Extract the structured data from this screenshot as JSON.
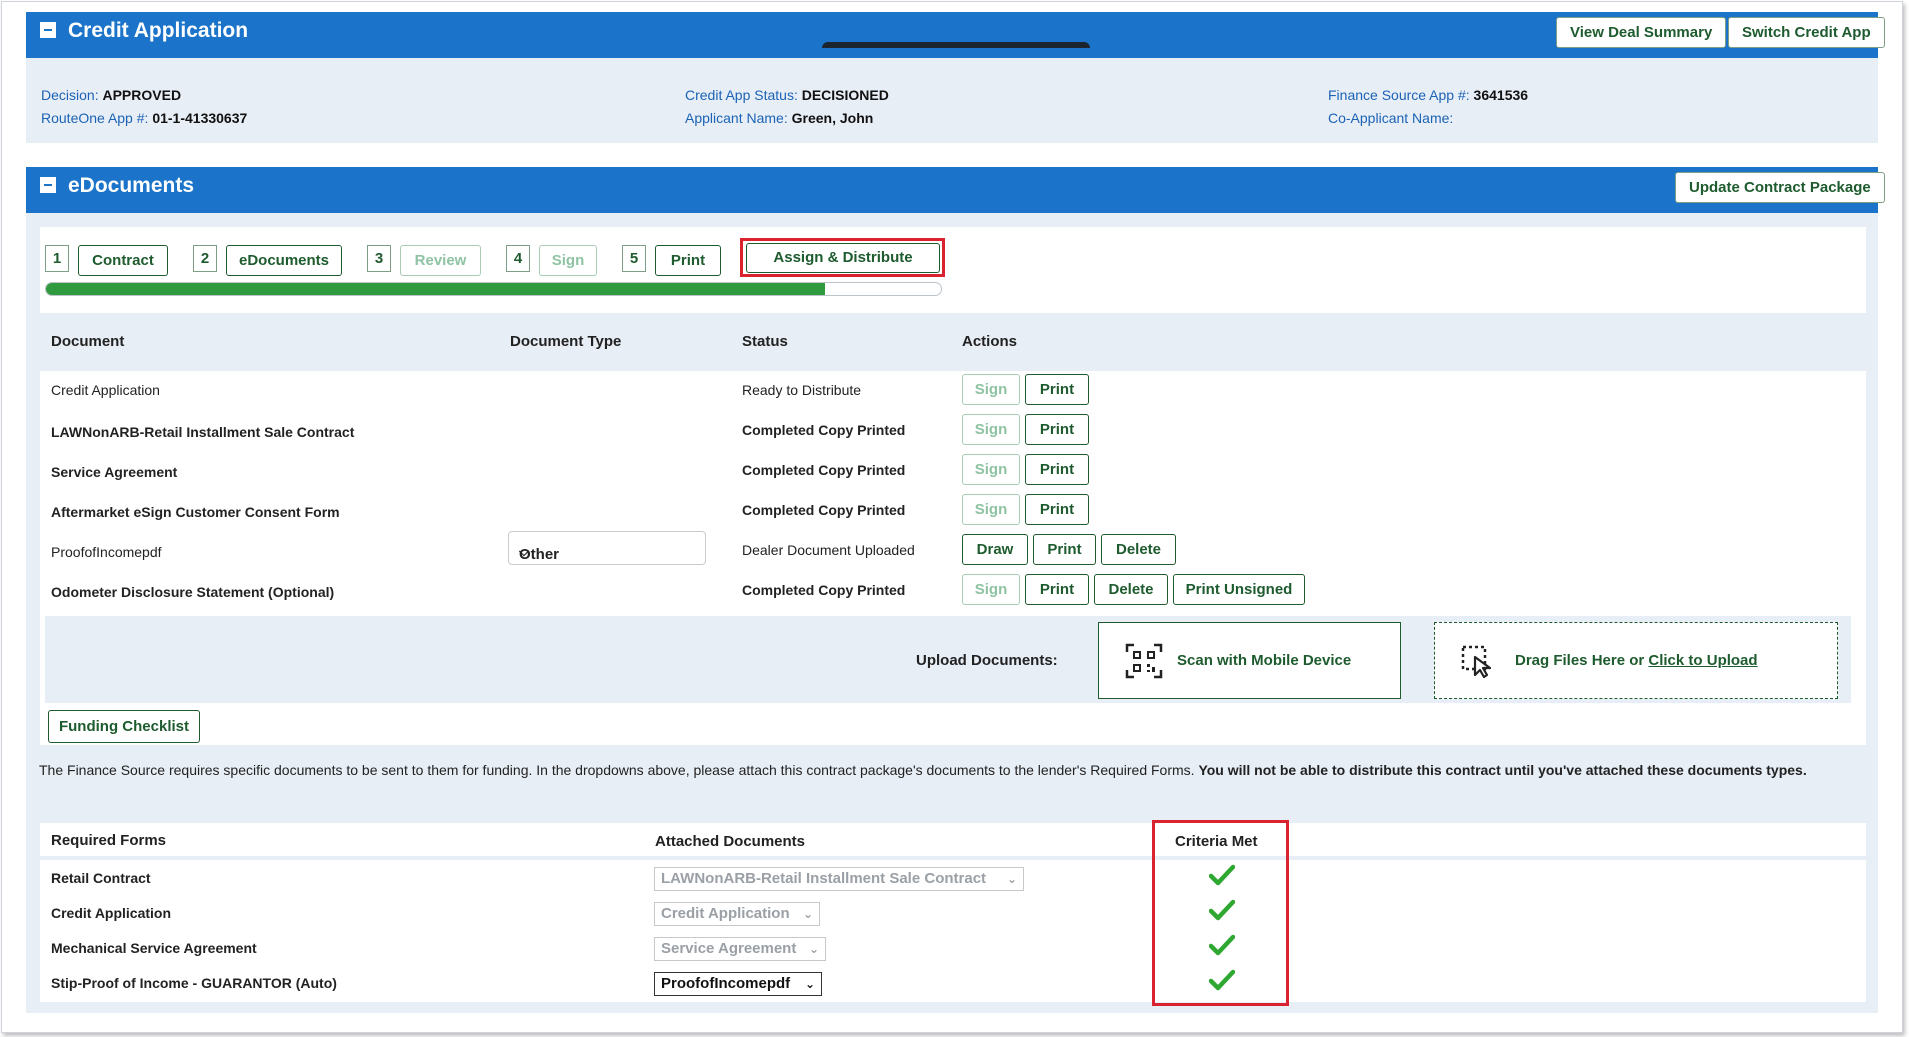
{
  "credit_app": {
    "title": "Credit Application",
    "buttons": [
      "View Deal Summary",
      "Switch Credit App"
    ],
    "decision_label": "Decision:",
    "decision_value": "APPROVED",
    "routeone_label": "RouteOne App #:",
    "routeone_value": "01-1-41330637",
    "status_label": "Credit App Status:",
    "status_value": "DECISIONED",
    "applicant_label": "Applicant Name:",
    "applicant_value": "Green, John",
    "finance_label": "Finance Source App #:",
    "finance_value": "3641536",
    "coapplicant_label": "Co-Applicant Name:",
    "coapplicant_value": ""
  },
  "edocs": {
    "title": "eDocuments",
    "update_button": "Update Contract Package",
    "steps": [
      {
        "num": "1",
        "label": "Contract",
        "enabled": true
      },
      {
        "num": "2",
        "label": "eDocuments",
        "enabled": true
      },
      {
        "num": "3",
        "label": "Review",
        "enabled": false
      },
      {
        "num": "4",
        "label": "Sign",
        "enabled": false
      },
      {
        "num": "5",
        "label": "Print",
        "enabled": true
      }
    ],
    "assign_button": "Assign & Distribute",
    "progress_fraction": 0.87,
    "columns": [
      "Document",
      "Document Type",
      "Status",
      "Actions"
    ],
    "rows": [
      {
        "document": "Credit Application",
        "status": "Ready to Distribute"
      },
      {
        "document": "LAWNonARB-Retail Installment Sale Contract",
        "status": "Completed Copy Printed"
      },
      {
        "document": "Service Agreement",
        "status": "Completed Copy Printed"
      },
      {
        "document": "Aftermarket eSign Customer Consent Form",
        "status": "Completed Copy Printed"
      },
      {
        "document": "ProofofIncomepdf",
        "doc_type": "Other",
        "status": "Dealer Document Uploaded"
      },
      {
        "document": "Odometer Disclosure Statement (Optional)",
        "status": "Completed Copy Printed"
      }
    ],
    "actions": {
      "sign": "Sign",
      "print": "Print",
      "draw": "Draw",
      "delete": "Delete",
      "print_unsigned": "Print Unsigned"
    },
    "upload_label": "Upload Documents:",
    "scan_label": "Scan with Mobile Device",
    "drag_prefix": "Drag Files Here or ",
    "drag_link": "Click to Upload",
    "funding_button": "Funding Checklist",
    "note_text": "The Finance Source requires specific documents to be sent to them for funding. In the dropdowns above, please attach this contract package's documents to the lender's Required Forms. ",
    "note_bold": "You will not be able to distribute this contract until you've attached these documents types.",
    "req_columns": [
      "Required Forms",
      "Attached Documents",
      "Criteria Met"
    ],
    "req_rows": [
      {
        "form": "Retail Contract",
        "attached": "LAWNonARB-Retail Installment Sale Contract",
        "met": true
      },
      {
        "form": "Credit Application",
        "attached": "Credit Application",
        "met": true
      },
      {
        "form": "Mechanical Service Agreement",
        "attached": "Service Agreement",
        "met": true
      },
      {
        "form": "Stip-Proof of Income - GUARANTOR (Auto)",
        "attached": "ProofofIncomepdf",
        "met": true
      }
    ],
    "colors": {
      "brand_blue": "#1b74c9",
      "green": "#1e5b2e",
      "check_green": "#2fa832",
      "highlight_red": "#d9232e"
    }
  }
}
